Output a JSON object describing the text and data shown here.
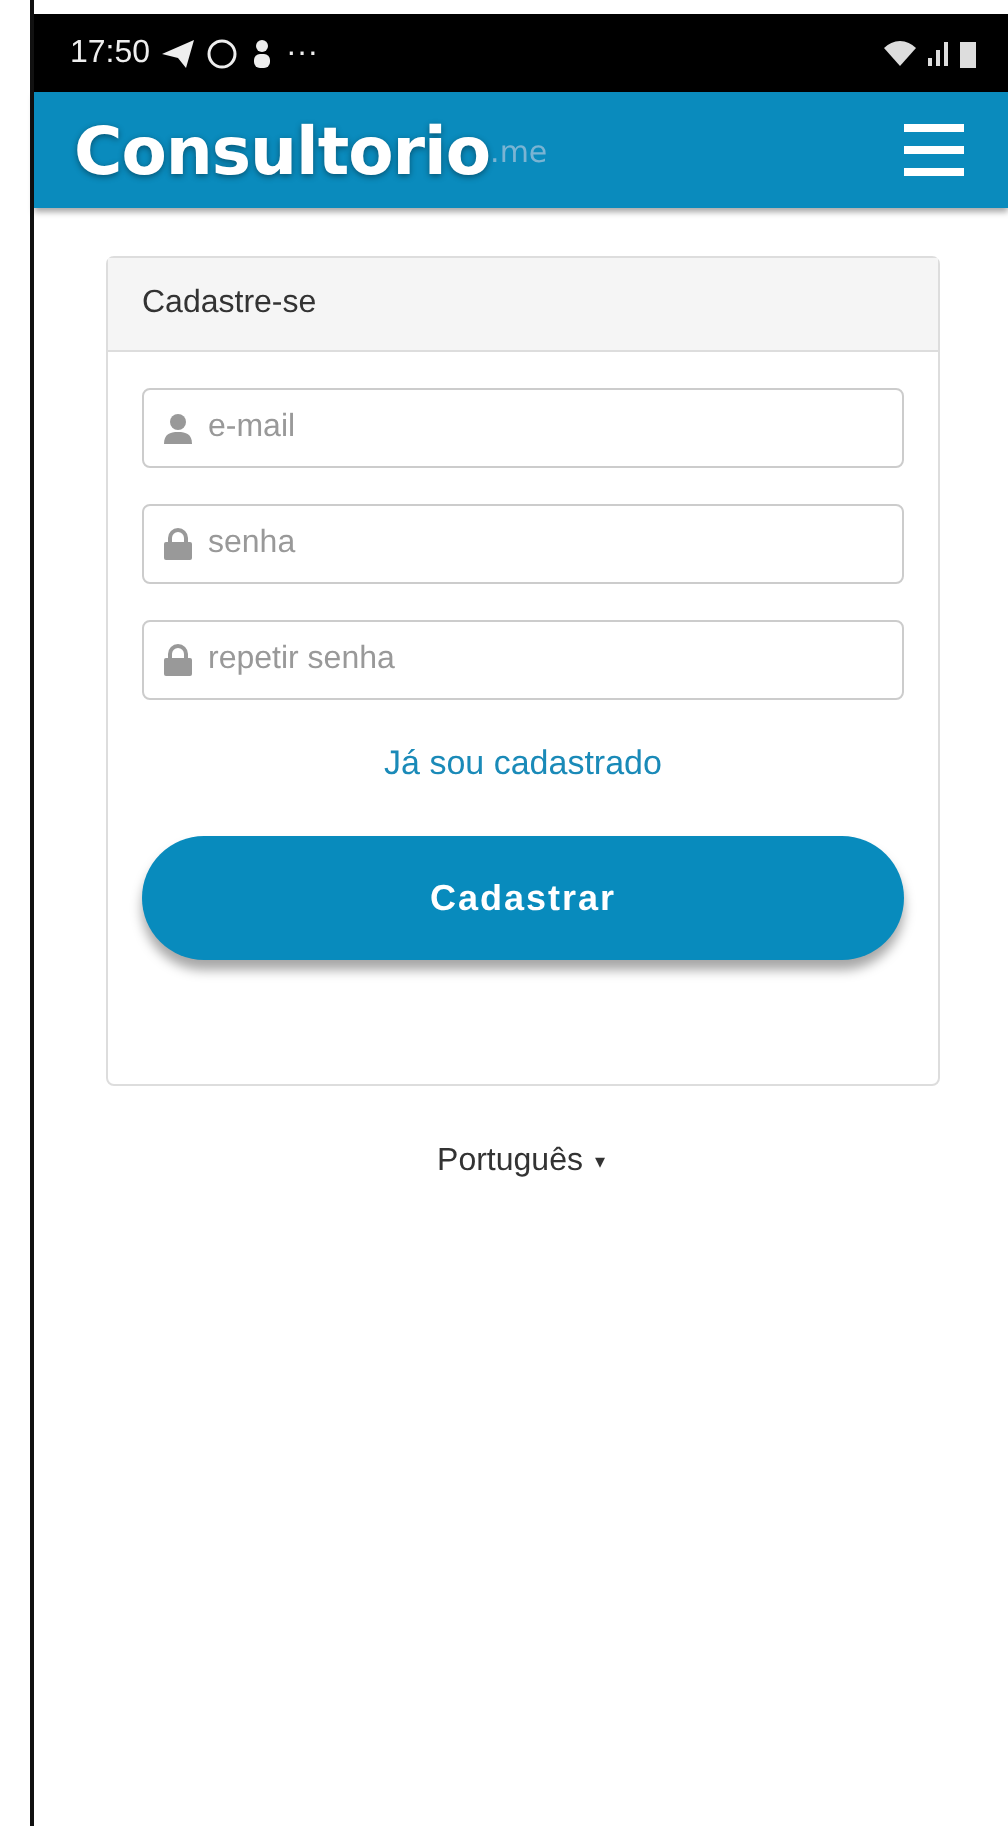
{
  "status_bar": {
    "time": "17:50",
    "more": "···"
  },
  "header": {
    "logo": "Consultorio",
    "logo_suffix": ".me"
  },
  "card": {
    "title": "Cadastre-se",
    "fields": [
      {
        "kind": "user",
        "placeholder": "e-mail"
      },
      {
        "kind": "lock",
        "placeholder": "senha"
      },
      {
        "kind": "lock",
        "placeholder": "repetir senha"
      }
    ],
    "link": "Já sou cadastrado",
    "button": "Cadastrar"
  },
  "language": {
    "label": "Português",
    "caret": "▾"
  }
}
